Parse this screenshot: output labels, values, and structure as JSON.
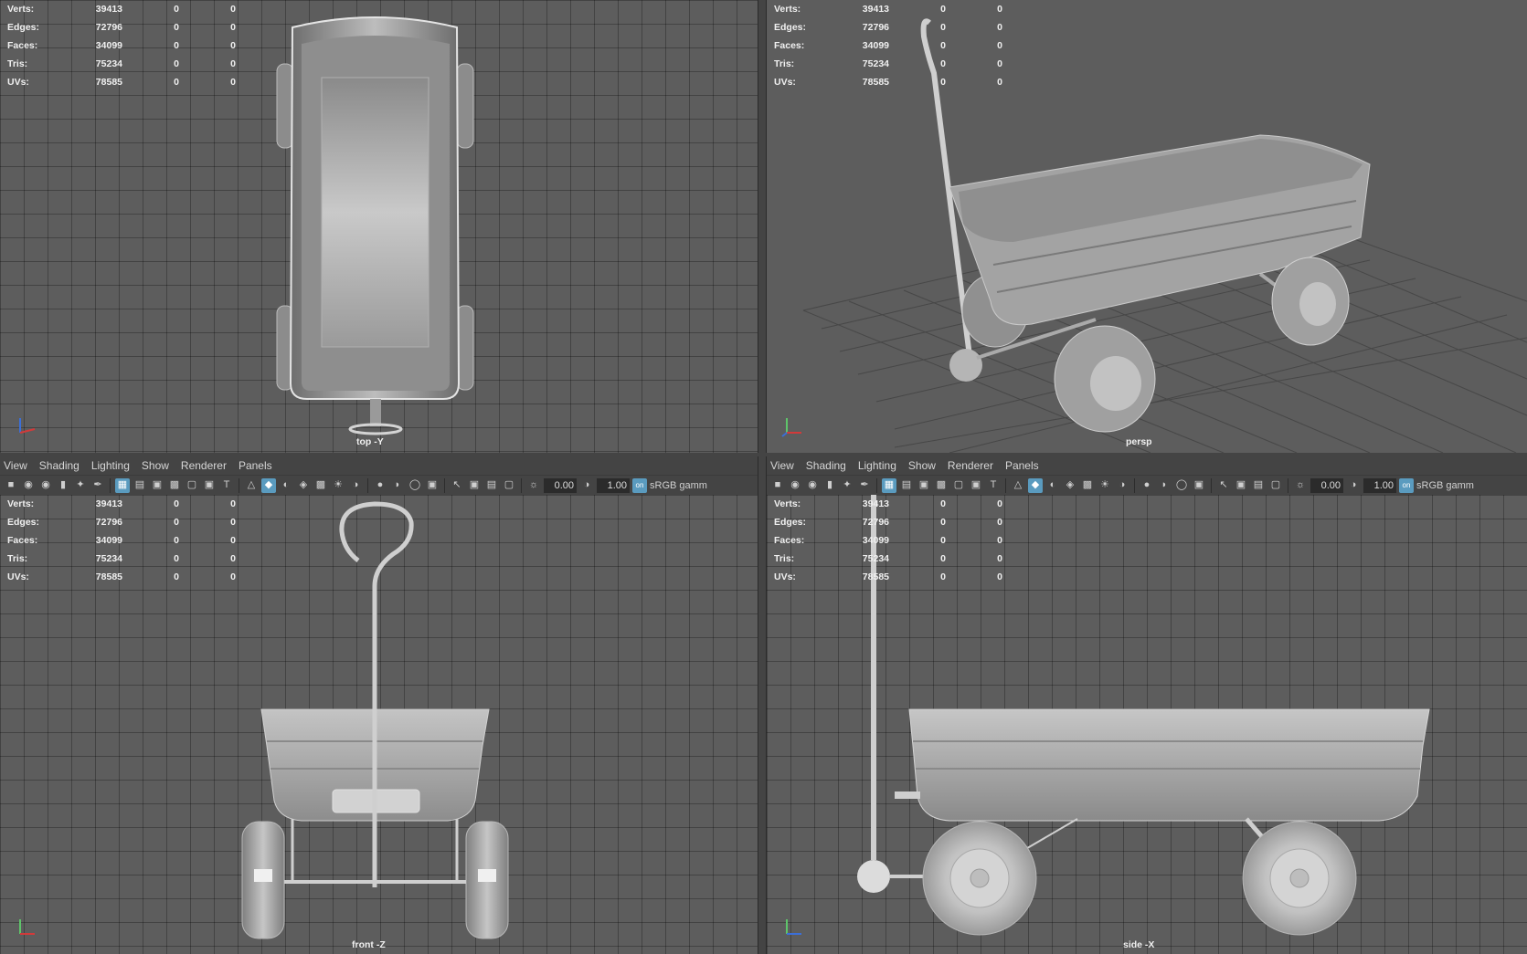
{
  "hud": [
    {
      "label": "Verts:",
      "value": "39413",
      "sel": "0",
      "comp": "0"
    },
    {
      "label": "Edges:",
      "value": "72796",
      "sel": "0",
      "comp": "0"
    },
    {
      "label": "Faces:",
      "value": "34099",
      "sel": "0",
      "comp": "0"
    },
    {
      "label": "Tris:",
      "value": "75234",
      "sel": "0",
      "comp": "0"
    },
    {
      "label": "UVs:",
      "value": "78585",
      "sel": "0",
      "comp": "0"
    }
  ],
  "viewports": {
    "top_left": {
      "camera": "top -Y"
    },
    "top_right": {
      "camera": "persp"
    },
    "bottom_left": {
      "camera": "front -Z"
    },
    "bottom_right": {
      "camera": "side -X"
    }
  },
  "panel_menu": [
    "View",
    "Shading",
    "Lighting",
    "Show",
    "Renderer",
    "Panels"
  ],
  "toolbar": {
    "exposure": "0.00",
    "gamma": "1.00",
    "color_management": "sRGB gamm",
    "cm_badge": "on"
  },
  "colors": {
    "viewport_bg": "#5d5d5d",
    "panel_bg": "#444444",
    "active_tool": "#5a9bbf",
    "axis_x": "#d23a3a",
    "axis_y": "#5ec46a",
    "axis_z": "#3b6fd8"
  }
}
